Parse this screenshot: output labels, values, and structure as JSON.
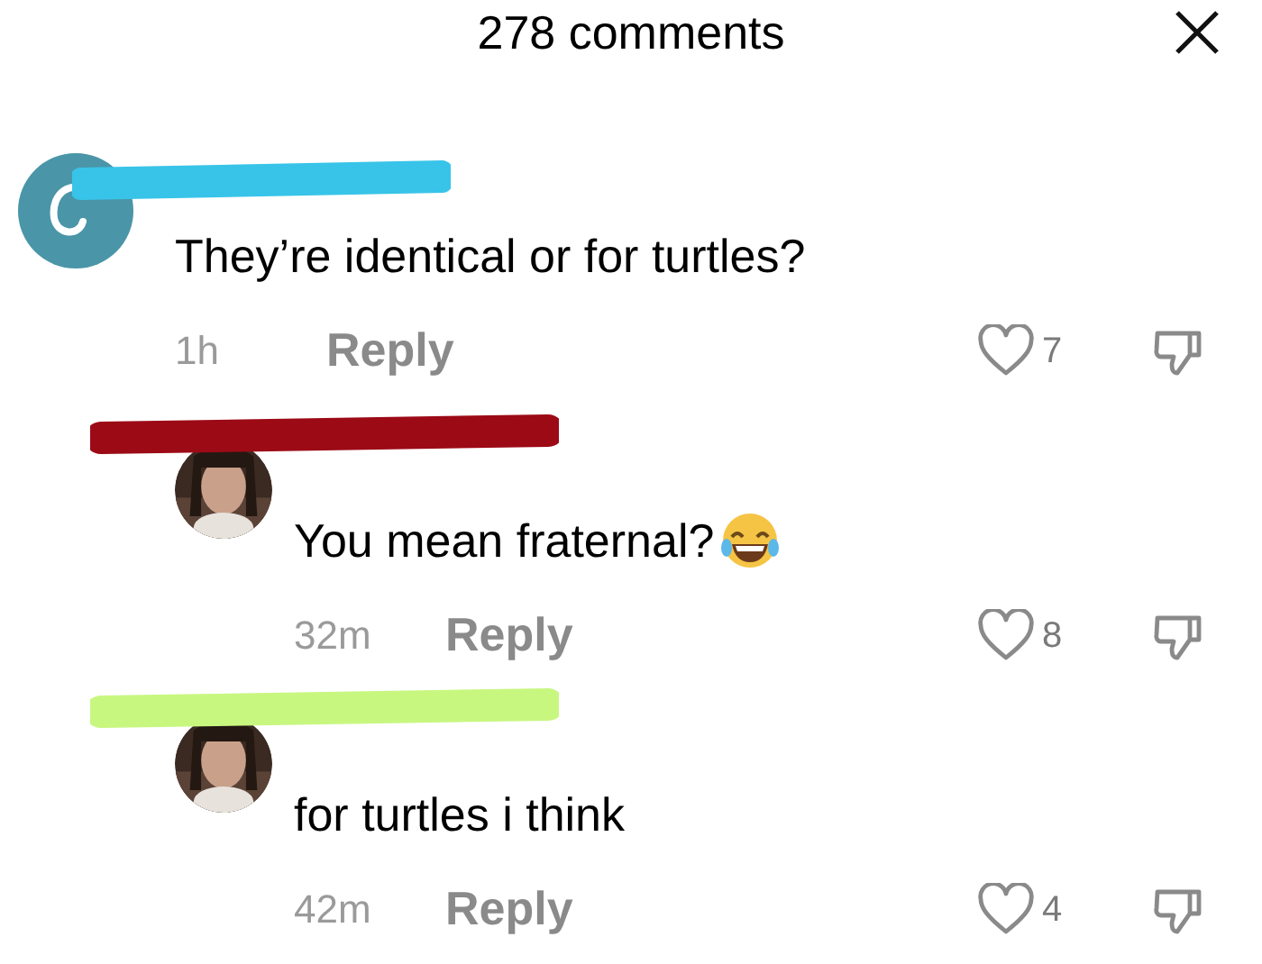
{
  "header": {
    "title": "278 comments"
  },
  "comments": [
    {
      "avatar": {
        "kind": "initial"
      },
      "scribble": {
        "color": "#38c4e8"
      },
      "text": "They’re identical or for turtles?",
      "emoji": false,
      "time": "1h",
      "reply": "Reply",
      "likes": "7",
      "children": [
        {
          "scribble": {
            "color": "#9c0a16"
          },
          "text": "You mean fraternal?",
          "emoji": true,
          "time": "32m",
          "reply": "Reply",
          "likes": "8"
        },
        {
          "scribble": {
            "color": "#c8f780"
          },
          "text": "for turtles i think",
          "emoji": false,
          "time": "42m",
          "reply": "Reply",
          "likes": "4"
        }
      ]
    }
  ]
}
